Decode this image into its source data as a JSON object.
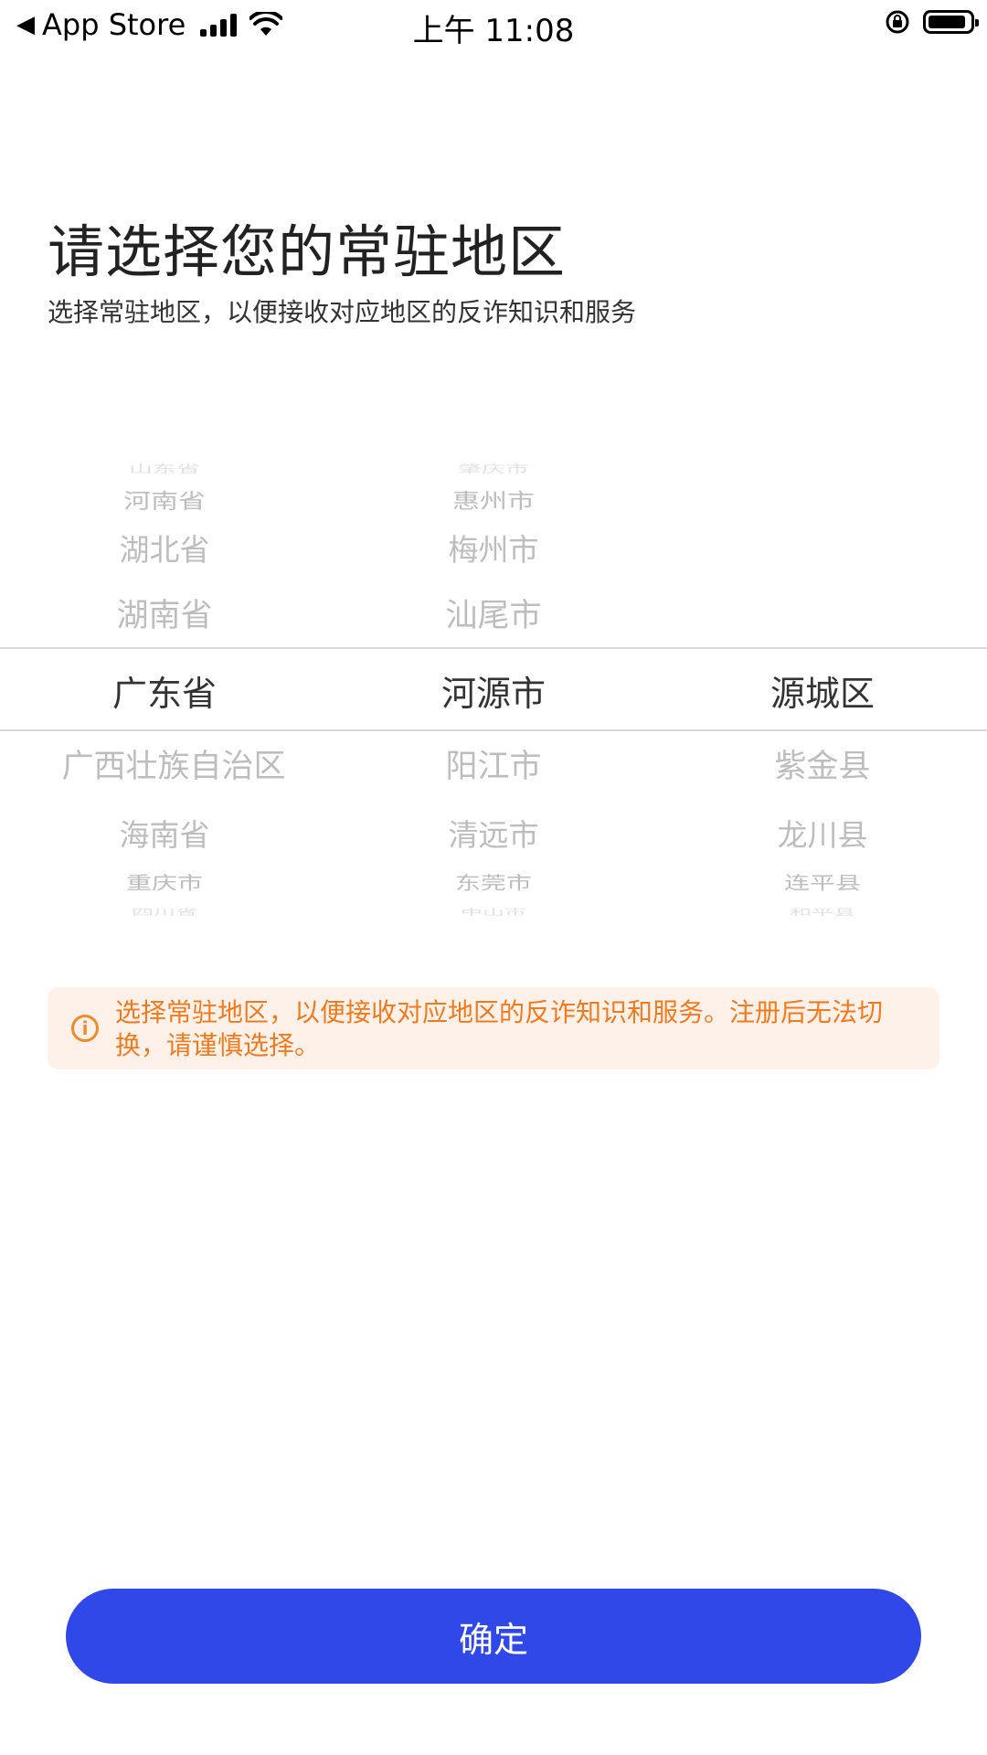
{
  "status_bar": {
    "back_app": "App Store",
    "time": "上午 11:08"
  },
  "page": {
    "title": "请选择您的常驻地区",
    "subtitle": "选择常驻地区，以便接收对应地区的反诈知识和服务"
  },
  "picker": {
    "provinces": {
      "above": [
        "山东省",
        "河南省",
        "湖北省",
        "湖南省"
      ],
      "selected": "广东省",
      "below": [
        "广西壮族自治区",
        "海南省",
        "重庆市",
        "四川省"
      ]
    },
    "cities": {
      "above": [
        "肇庆市",
        "惠州市",
        "梅州市",
        "汕尾市"
      ],
      "selected": "河源市",
      "below": [
        "阳江市",
        "清远市",
        "东莞市",
        "中山市"
      ]
    },
    "districts": {
      "selected": "源城区",
      "below": [
        "紫金县",
        "龙川县",
        "连平县",
        "和平县"
      ]
    }
  },
  "notice": {
    "icon": "info-icon",
    "text": "选择常驻地区，以便接收对应地区的反诈知识和服务。注册后无法切换，请谨慎选择。"
  },
  "confirm_label": "确定",
  "colors": {
    "accent": "#3048e8",
    "notice_text": "#f07a1e",
    "notice_bg": "#fdf1ea"
  }
}
